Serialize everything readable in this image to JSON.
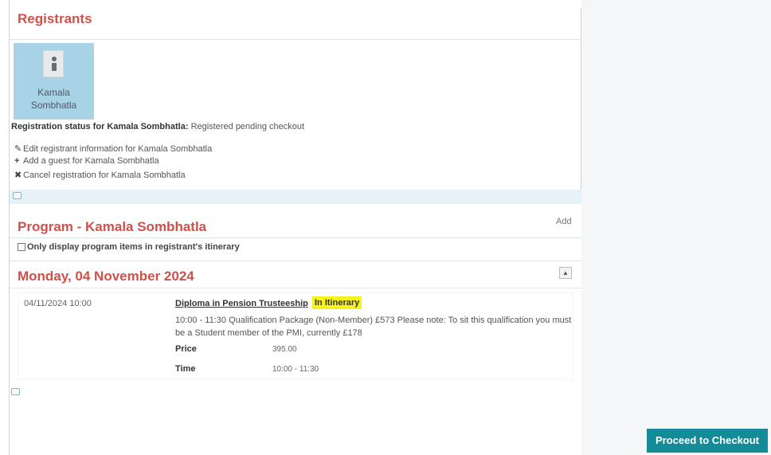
{
  "registrants": {
    "title": "Registrants",
    "tile_name": "Kamala Sombhatla",
    "status_label": "Registration status for Kamala Sombhatla:",
    "status_value": "Registered pending checkout",
    "actions": [
      {
        "icon": "pencil-icon",
        "label": "Edit registrant information for Kamala Sombhatla"
      },
      {
        "icon": "plus-icon",
        "label": "Add a guest for Kamala Sombhatla"
      },
      {
        "icon": "x-icon",
        "label": "Cancel registration for Kamala Sombhatla"
      }
    ]
  },
  "program": {
    "title": "Program - Kamala Sombhatla",
    "add_label": "Add",
    "only_display_label": "Only display program items in registrant's itinerary",
    "day_title": "Monday, 04 November 2024",
    "item": {
      "date": "04/11/2024 10:00",
      "name": "Diploma in Pension Trusteeship",
      "badge": "In Itinerary",
      "description": "10:00 - 11:30 Qualification Package (Non-Member) £573 Please note: To sit this qualification you must be a Student member of the PMI, currently £178",
      "price_label": "Price",
      "price_value": "395.00",
      "time_label": "Time",
      "time_value": "10:00 - 11:30"
    }
  },
  "checkout": {
    "label": "Proceed to Checkout"
  },
  "colors": {
    "heading": "#d0504a",
    "tile": "#a8d3e6",
    "badge": "#f7f11e",
    "checkout": "#138b98"
  }
}
